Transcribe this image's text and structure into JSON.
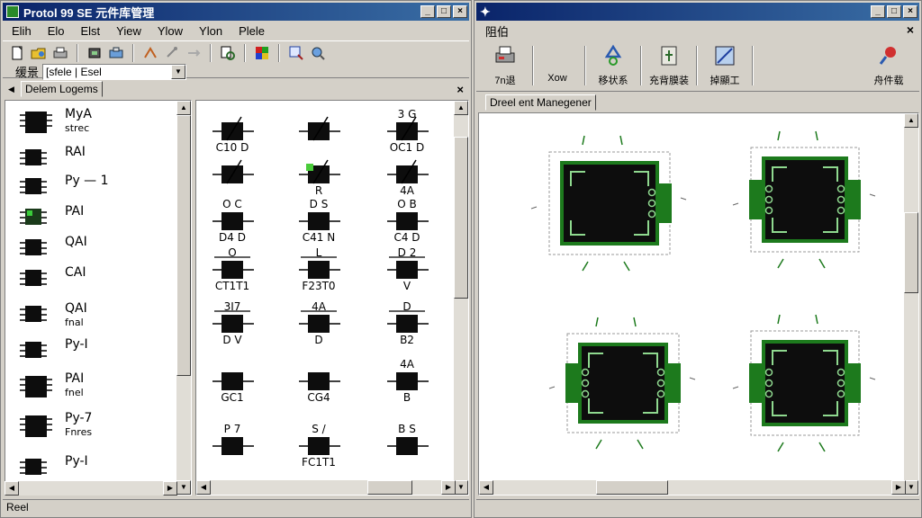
{
  "left_window": {
    "title": "Protol 99 SE 元件库管理",
    "menu": [
      "Elih",
      "Elo",
      "Elst",
      "Yiew",
      "Ylow",
      "Ylon",
      "Plele"
    ],
    "combo_label": "缓景",
    "combo_value": "[sfele | Esel",
    "panel_tab": "Delem Logems",
    "status": "Reel",
    "library_items": [
      {
        "label": "MyA",
        "sub": "strec"
      },
      {
        "label": "RAI",
        "sub": ""
      },
      {
        "label": "Py — 1",
        "sub": ""
      },
      {
        "label": "PAI",
        "sub": ""
      },
      {
        "label": "QAI",
        "sub": ""
      },
      {
        "label": "CAI",
        "sub": ""
      },
      {
        "label": "QAI",
        "sub": "fnal"
      },
      {
        "label": "Py-I",
        "sub": ""
      },
      {
        "label": "PAI",
        "sub": "fnel"
      },
      {
        "label": "Py-7",
        "sub": "Fnres"
      },
      {
        "label": "Py-I",
        "sub": ""
      }
    ],
    "symbols": [
      {
        "top": "",
        "bottom": "C10 D"
      },
      {
        "top": "",
        "bottom": ""
      },
      {
        "top": "3 G",
        "bottom": "OC1 D"
      },
      {
        "top": "",
        "bottom": ""
      },
      {
        "top": "",
        "bottom": "R"
      },
      {
        "top": "",
        "bottom": "4A"
      },
      {
        "top": "O C",
        "bottom": "D4 D"
      },
      {
        "top": "D S",
        "bottom": "C41 N"
      },
      {
        "top": "O B",
        "bottom": "C4 D"
      },
      {
        "top": "O",
        "bottom": "CT1T1"
      },
      {
        "top": "L",
        "bottom": "F23T0"
      },
      {
        "top": "D 2",
        "bottom": "V"
      },
      {
        "top": "3I7",
        "bottom": "D V"
      },
      {
        "top": "4A",
        "bottom": "D"
      },
      {
        "top": "D",
        "bottom": "B2"
      },
      {
        "top": "",
        "bottom": "GC1"
      },
      {
        "top": "",
        "bottom": "CG4"
      },
      {
        "top": "4A",
        "bottom": "B"
      },
      {
        "top": "P 7",
        "bottom": ""
      },
      {
        "top": "S /",
        "bottom": "FC1T1"
      },
      {
        "top": "B S",
        "bottom": ""
      }
    ]
  },
  "right_window": {
    "menu": [
      "阻伯"
    ],
    "tools": [
      {
        "label": "7n退",
        "icon": "printer-icon"
      },
      {
        "label": "Xow",
        "icon": "blank-icon"
      },
      {
        "label": "移状系",
        "icon": "recycle-icon"
      },
      {
        "label": "充背膜装",
        "icon": "component-icon"
      },
      {
        "label": "掉顯工",
        "icon": "measure-icon"
      },
      {
        "label": "舟件载",
        "icon": "pushpin-icon"
      }
    ],
    "panel_tab": "Dreel ent Manegener"
  },
  "colors": {
    "titlebar": "#0a246a",
    "chip_body": "#0d0d0d",
    "pcb_green": "#1d7a1d",
    "pad_trace": "#8fd98f"
  }
}
